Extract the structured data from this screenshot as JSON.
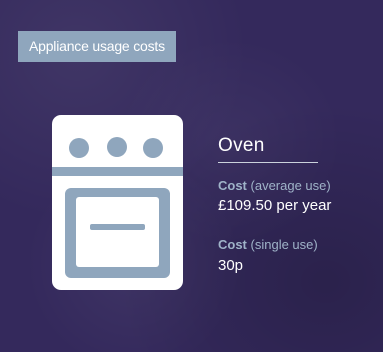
{
  "header": {
    "tag_label": "Appliance usage costs"
  },
  "appliance": {
    "icon": "oven-icon",
    "name": "Oven"
  },
  "costs": [
    {
      "heading": "Cost",
      "qualifier": "(average use)",
      "value": "£109.50 per year"
    },
    {
      "heading": "Cost",
      "qualifier": "(single use)",
      "value": "30p"
    }
  ],
  "colors": {
    "background": "#34295c",
    "accent": "#8fa6bd",
    "label": "#9fb3c8",
    "text": "#ffffff"
  }
}
